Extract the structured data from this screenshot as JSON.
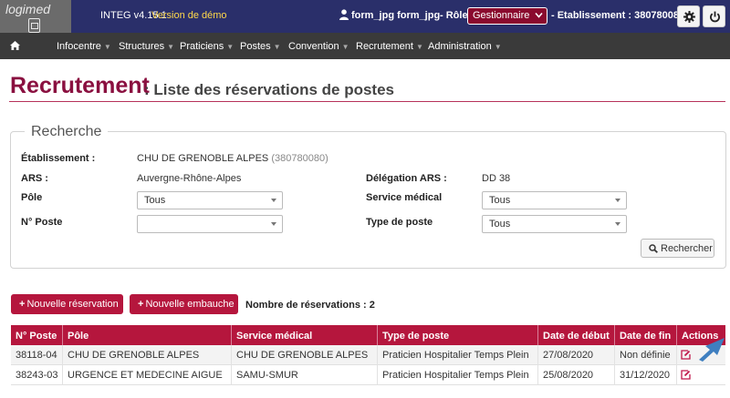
{
  "header": {
    "logo_text": "logimed",
    "app_version": "INTEG v4.15.1",
    "demo_label": "Version de démo",
    "user_name": "form_jpg form_jpg",
    "role_label": "- Rôle :",
    "role_value": "Gestionnaire",
    "etablissement": "- Etablissement : 380780080",
    "icons": [
      "user-icon",
      "gear-icon",
      "power-icon"
    ]
  },
  "nav": {
    "items": [
      "Infocentre",
      "Structures",
      "Praticiens",
      "Postes",
      "Convention",
      "Recrutement",
      "Administration"
    ]
  },
  "page": {
    "title": "Recrutement",
    "subtitle": ": Liste des réservations de postes"
  },
  "search": {
    "legend": "Recherche",
    "etablissement_label": "Établissement :",
    "etablissement_value": "CHU DE GRENOBLE ALPES",
    "etablissement_code": "(380780080)",
    "ars_label": "ARS :",
    "ars_value": "Auvergne-Rhône-Alpes",
    "delegation_label": "Délégation ARS :",
    "delegation_value": "DD 38",
    "pole_label": "Pôle",
    "pole_value": "Tous",
    "service_label": "Service médical",
    "service_value": "Tous",
    "poste_label": "N° Poste",
    "poste_value": "",
    "type_label": "Type de poste",
    "type_value": "Tous",
    "search_button": "Rechercher"
  },
  "actions": {
    "new_reservation": "Nouvelle réservation",
    "new_hire": "Nouvelle embauche",
    "count_text": "Nombre de réservations : 2"
  },
  "table": {
    "columns": [
      "N° Poste",
      "Pôle",
      "Service médical",
      "Type de poste",
      "Date de début",
      "Date de fin",
      "Actions"
    ],
    "rows": [
      [
        "38118-04",
        "CHU DE GRENOBLE ALPES",
        "CHU DE GRENOBLE ALPES",
        "Praticien Hospitalier Temps Plein",
        "27/08/2020",
        "Non définie"
      ],
      [
        "38243-03",
        "URGENCE ET MEDECINE AIGUE",
        "SAMU-SMUR",
        "Praticien Hospitalier Temps Plein",
        "25/08/2020",
        "31/12/2020"
      ]
    ]
  },
  "colors": {
    "header_bg": "#2a2f6a",
    "nav_bg": "#3a3a3a",
    "accent": "#b5163d",
    "title_color": "#8a1040",
    "demo_color": "#ffd84a",
    "arrow_color": "#3f7fc0"
  }
}
